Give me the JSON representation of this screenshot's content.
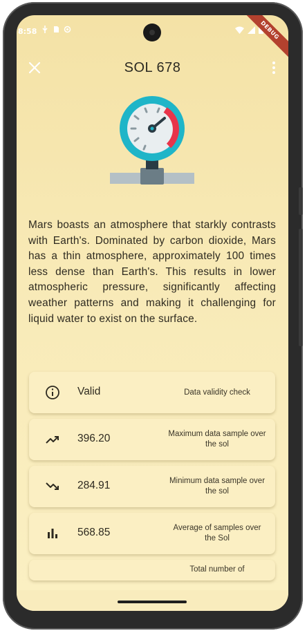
{
  "status_bar": {
    "time": "8:58",
    "debug_label": "DEBUG"
  },
  "app_bar": {
    "title": "SOL 678",
    "close_icon": "close-icon",
    "menu_icon": "more-vert-icon"
  },
  "hero": {
    "icon": "pressure-gauge-icon",
    "colors": {
      "ring": "#1fb5c8",
      "needle_zone": "#e8344a",
      "pipe": "#b4c0c6",
      "valve": "#6b7d86"
    }
  },
  "description": "Mars boasts an atmosphere that starkly contrasts with Earth's. Dominated by carbon dioxide, Mars has a thin atmosphere, approximately 100 times less dense than Earth's. This results in lower atmospheric pressure, significantly affecting weather patterns and making it challenging for liquid water to exist on the surface.",
  "stats": [
    {
      "icon": "info-icon",
      "value": "Valid",
      "label": "Data validity check"
    },
    {
      "icon": "trending-up-icon",
      "value": "396.20",
      "label": "Maximum data sample over the sol"
    },
    {
      "icon": "trending-down-icon",
      "value": "284.91",
      "label": "Minimum data sample over the sol"
    },
    {
      "icon": "bar-chart-icon",
      "value": "568.85",
      "label": "Average of samples over the Sol"
    },
    {
      "icon": "",
      "value": "",
      "label": "Total number of"
    }
  ],
  "colors": {
    "background": "#f7e7b0",
    "card": "#fbefc3",
    "text": "#2e2a20"
  }
}
